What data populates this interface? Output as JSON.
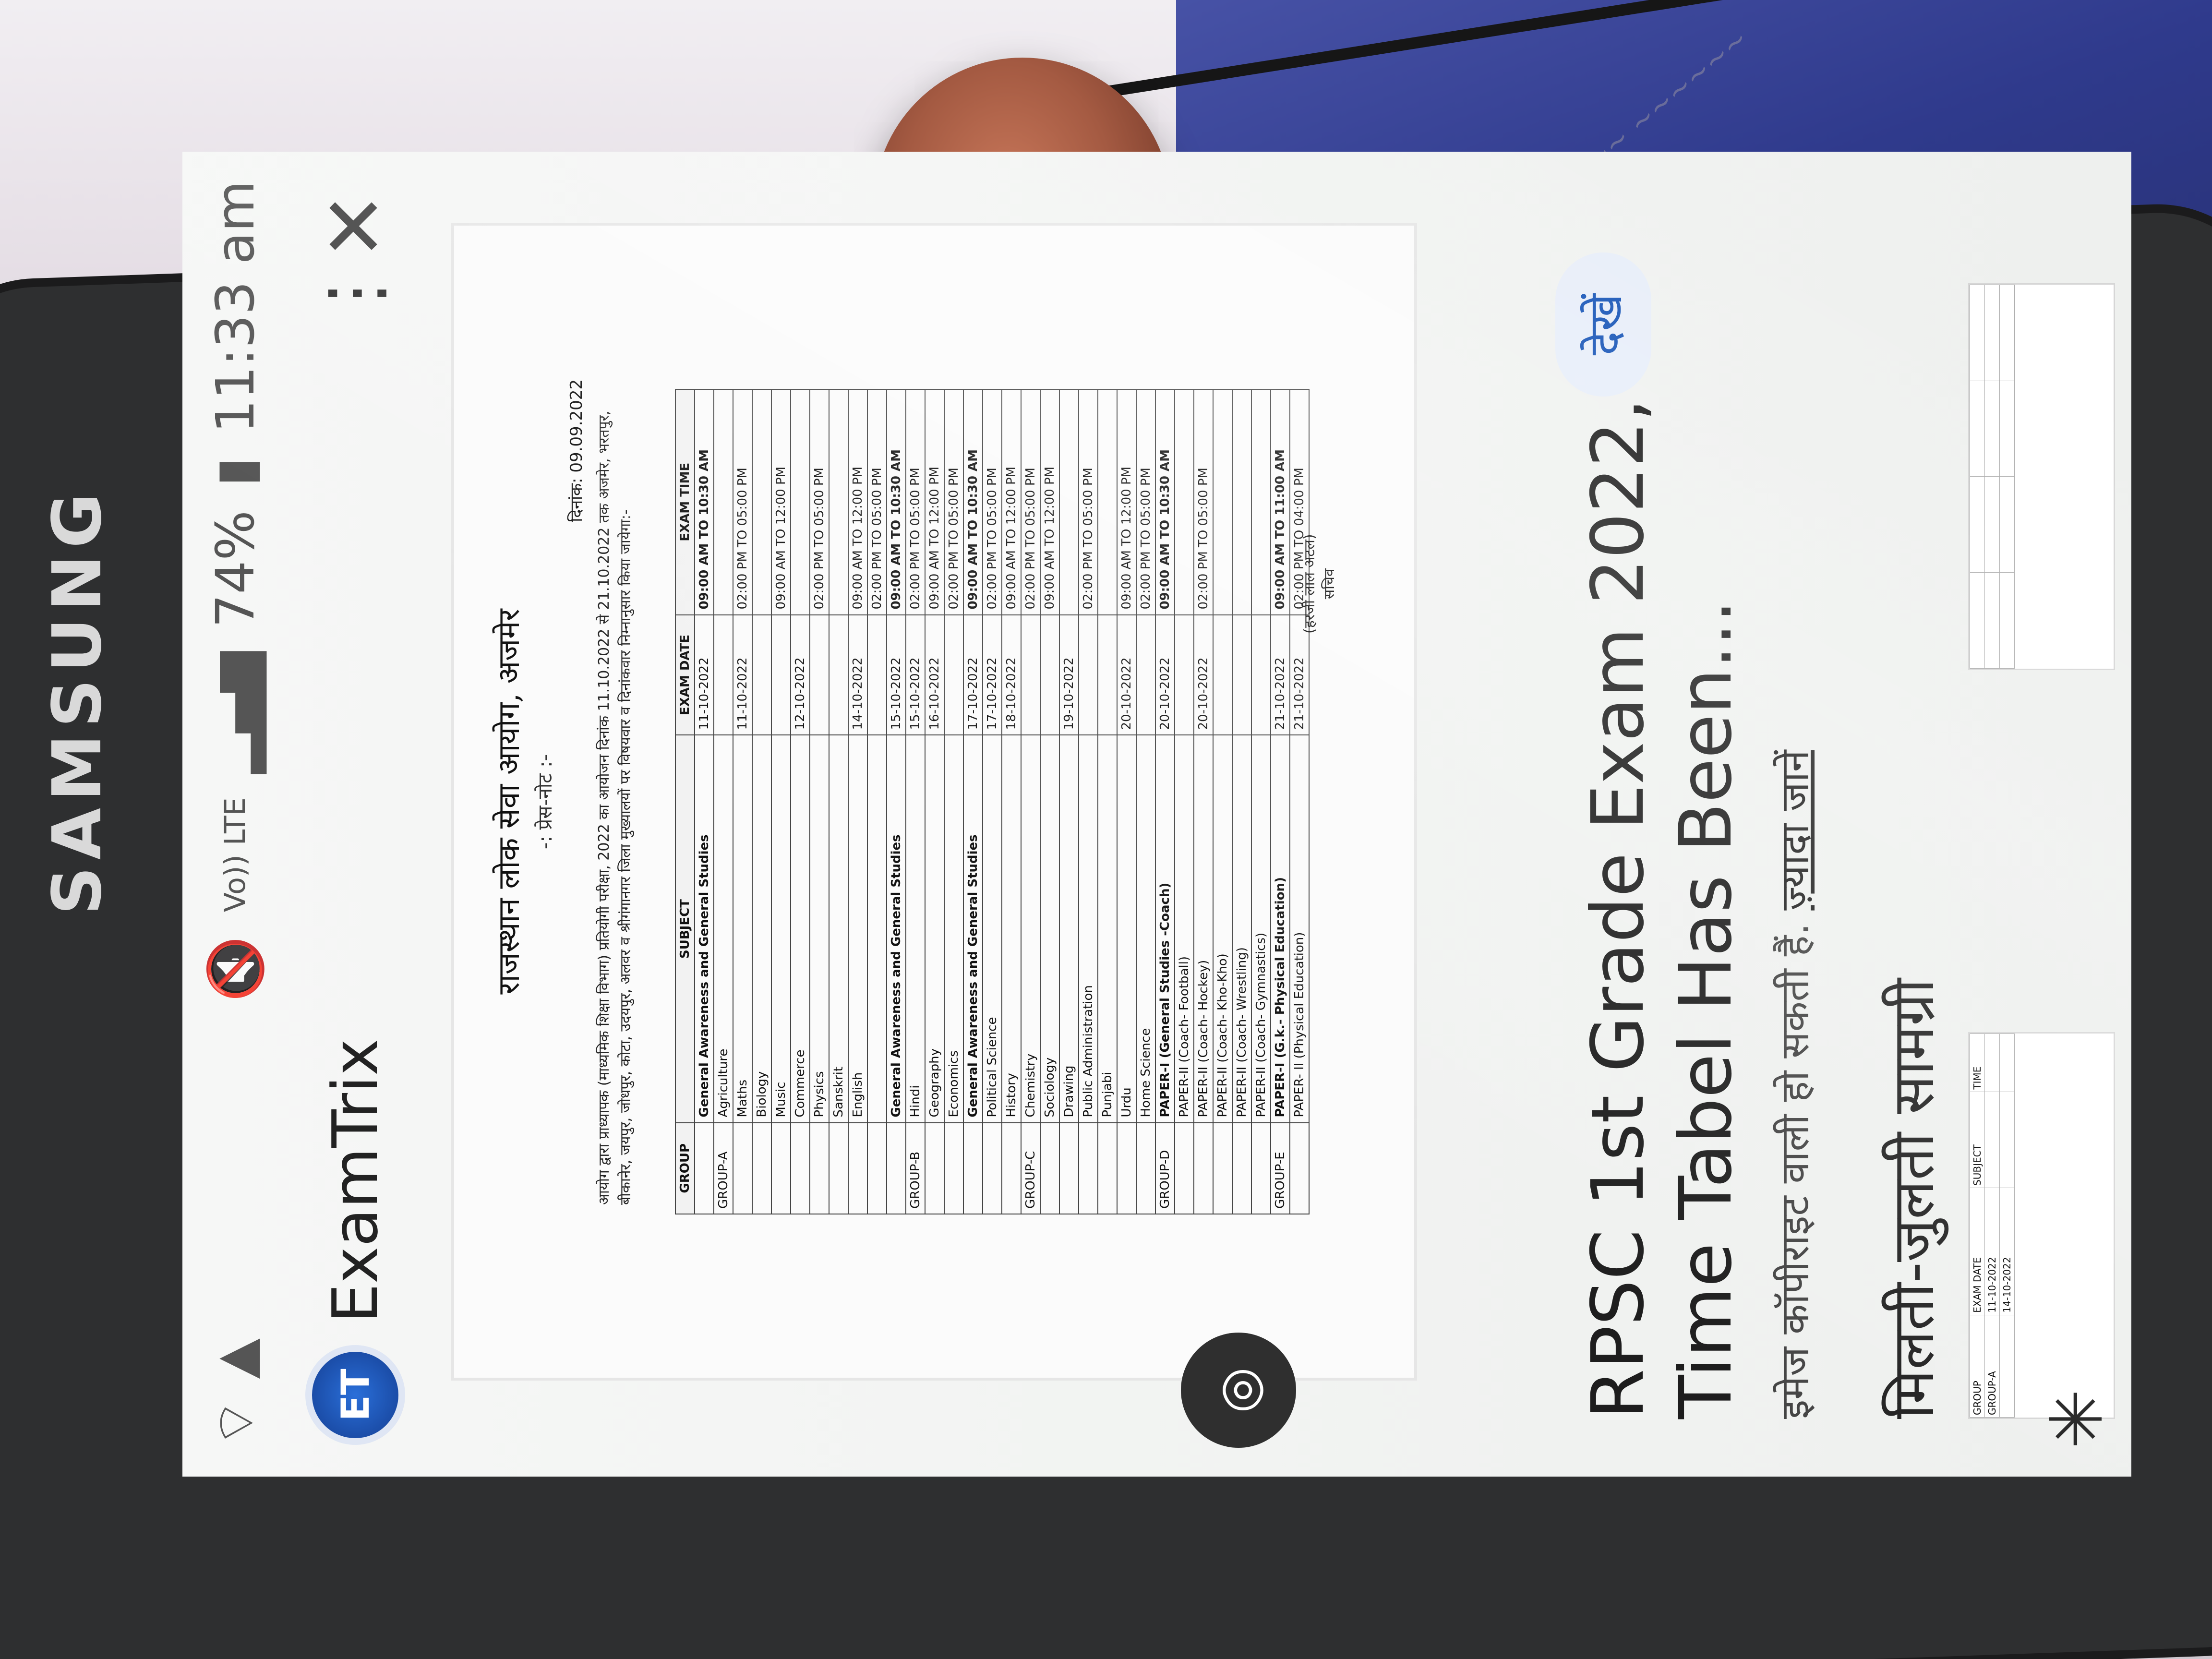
{
  "device": {
    "brand": "SAMSUNG"
  },
  "status_bar": {
    "network": "Vo)) LTE",
    "battery": "74%",
    "time": "11:33 am"
  },
  "app": {
    "logo": "ET",
    "title": "ExamTrix",
    "icons": {
      "menu": "more-vert-icon",
      "close": "close-icon",
      "scan": "lens-icon",
      "fab": "asterisk-icon"
    }
  },
  "document": {
    "heading": "राजस्थान लोक सेवा आयोग, अजमेर",
    "subheading": "-: प्रेस-नोट :-",
    "date_label": "दिनांक: 09.09.2022",
    "body": "आयोग द्वारा प्राध्यापक (माध्यमिक शिक्षा विभाग) प्रतियोगी परीक्षा, 2022 का आयोजन दिनांक 11.10.2022 से 21.10.2022 तक अजमेर, भरतपुर, बीकानेर, जयपुर, जोधपुर, कोटा, उदयपुर, अलवर व श्रीगंगानगर जिला मुख्यालयों पर विषयवार व दिनांकवार निम्नानुसार किया जायेगा:-",
    "table": {
      "headers": [
        "GROUP",
        "SUBJECT",
        "EXAM DATE",
        "EXAM TIME"
      ],
      "rows": [
        [
          "",
          "General Awareness and General Studies",
          "11-10-2022",
          "09:00 AM TO 10:30 AM"
        ],
        [
          "GROUP-A",
          "Agriculture",
          "",
          ""
        ],
        [
          "",
          "Maths",
          "11-10-2022",
          "02:00 PM TO 05:00 PM"
        ],
        [
          "",
          "Biology",
          "",
          ""
        ],
        [
          "",
          "Music",
          "",
          "09:00 AM TO 12:00 PM"
        ],
        [
          "",
          "Commerce",
          "12-10-2022",
          ""
        ],
        [
          "",
          "Physics",
          "",
          "02:00 PM TO 05:00 PM"
        ],
        [
          "",
          "Sanskrit",
          "",
          ""
        ],
        [
          "",
          "English",
          "14-10-2022",
          "09:00 AM TO 12:00 PM"
        ],
        [
          "",
          "",
          "",
          "02:00 PM TO 05:00 PM"
        ],
        [
          "",
          "General Awareness and General Studies",
          "15-10-2022",
          "09:00 AM TO 10:30 AM"
        ],
        [
          "GROUP-B",
          "Hindi",
          "15-10-2022",
          "02:00 PM TO 05:00 PM"
        ],
        [
          "",
          "Geography",
          "16-10-2022",
          "09:00 AM TO 12:00 PM"
        ],
        [
          "",
          "Economics",
          "",
          "02:00 PM TO 05:00 PM"
        ],
        [
          "",
          "General Awareness and General Studies",
          "17-10-2022",
          "09:00 AM TO 10:30 AM"
        ],
        [
          "",
          "Political Science",
          "17-10-2022",
          "02:00 PM TO 05:00 PM"
        ],
        [
          "",
          "History",
          "18-10-2022",
          "09:00 AM TO 12:00 PM"
        ],
        [
          "GROUP-C",
          "Chemistry",
          "",
          "02:00 PM TO 05:00 PM"
        ],
        [
          "",
          "Sociology",
          "",
          "09:00 AM TO 12:00 PM"
        ],
        [
          "",
          "Drawing",
          "19-10-2022",
          ""
        ],
        [
          "",
          "Public Administration",
          "",
          "02:00 PM TO 05:00 PM"
        ],
        [
          "",
          "Punjabi",
          "",
          ""
        ],
        [
          "",
          "Urdu",
          "20-10-2022",
          "09:00 AM TO 12:00 PM"
        ],
        [
          "",
          "Home Science",
          "",
          "02:00 PM TO 05:00 PM"
        ],
        [
          "GROUP-D",
          "PAPER-I (General Studies -Coach)",
          "20-10-2022",
          "09:00 AM TO 10:30 AM"
        ],
        [
          "",
          "PAPER-II (Coach- Football)",
          "",
          ""
        ],
        [
          "",
          "PAPER-II (Coach- Hockey)",
          "20-10-2022",
          "02:00 PM TO 05:00 PM"
        ],
        [
          "",
          "PAPER-II (Coach- Kho-Kho)",
          "",
          ""
        ],
        [
          "",
          "PAPER-II (Coach- Wrestling)",
          "",
          ""
        ],
        [
          "",
          "PAPER-II (Coach- Gymnastics)",
          "",
          ""
        ],
        [
          "GROUP-E",
          "PAPER-I (G.k.- Physical Education)",
          "21-10-2022",
          "09:00 AM TO 11:00 AM"
        ],
        [
          "",
          "PAPER- II (Physical Education)",
          "21-10-2022",
          "02:00 PM TO 04:00 PM"
        ]
      ]
    },
    "signature": "(हरजी लाल अटल)\nसचिव"
  },
  "result": {
    "headline": "RPSC 1st Grade Exam 2022, Time Tabel Has Been...",
    "view_button": "देखें",
    "copyright_note": "इमेज कॉपीराइट वाली हो सकती हैं.",
    "learn_more": "ज़्यादा जानें",
    "similar_heading": "मिलती-जुलती सामग्री"
  },
  "thumbnails": [
    {
      "rows": [
        [
          "GROUP",
          "EXAM DATE",
          "SUBJECT",
          "TIME"
        ],
        [
          "GROUP-A",
          "11-10-2022",
          "",
          ""
        ],
        [
          "",
          "14-10-2022",
          "",
          ""
        ]
      ]
    },
    {
      "rows": [
        [
          "",
          "",
          "",
          ""
        ],
        [
          "",
          "",
          "",
          ""
        ],
        [
          "",
          "",
          "",
          ""
        ]
      ]
    }
  ]
}
